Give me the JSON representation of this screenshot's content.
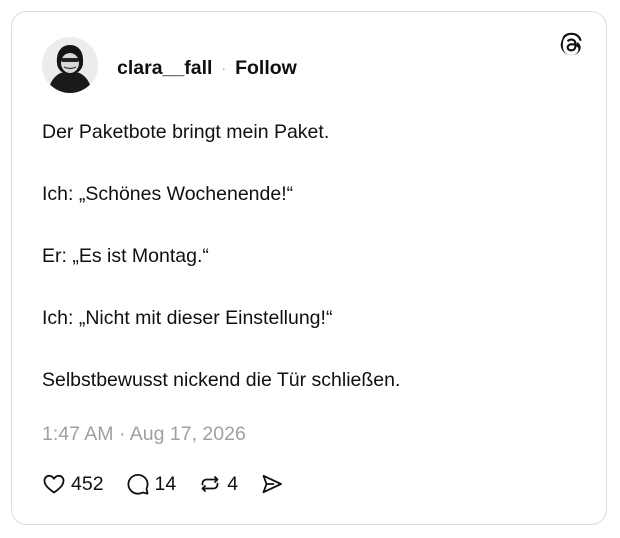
{
  "post": {
    "author": {
      "username": "clara__fall",
      "separator": "·",
      "follow_label": "Follow"
    },
    "lines": [
      "Der Paketbote bringt mein Paket.",
      "Ich: „Schönes Wochenende!“",
      "Er: „Es ist Montag.“",
      "Ich: „Nicht mit dieser Einstellung!“",
      "Selbstbewusst nickend die Tür schließen."
    ],
    "timestamp": "1:47 AM · Aug 17, 2026",
    "stats": {
      "likes": "452",
      "replies": "14",
      "reposts": "4"
    }
  },
  "icons": {
    "logo": "threads-logo-icon",
    "like": "heart-icon",
    "reply": "speech-bubble-icon",
    "repost": "repost-icon",
    "share": "send-icon"
  },
  "colors": {
    "text": "#101010",
    "muted": "#a0a0a0",
    "border": "#dcdcdc"
  }
}
